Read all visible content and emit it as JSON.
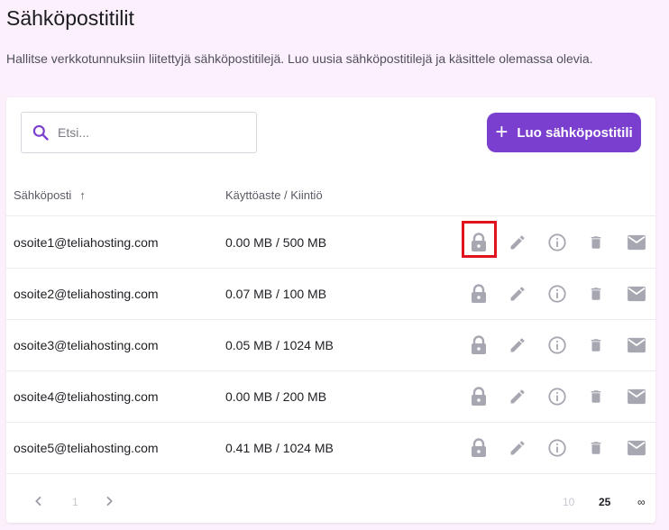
{
  "page": {
    "title": "Sähköpostitilit",
    "description": "Hallitse verkkotunnuksiin liitettyjä sähköpostitilejä. Luo uusia sähköpostitilejä ja käsittele olemassa olevia."
  },
  "toolbar": {
    "search_placeholder": "Etsi...",
    "create_label": "Luo sähköpostitili"
  },
  "table": {
    "columns": [
      "Sähköposti",
      "Käyttöaste / Kiintiö"
    ],
    "sort_indicator": "↑",
    "rows": [
      {
        "email": "osoite1@teliahosting.com",
        "usage": "0.00 MB / 500 MB"
      },
      {
        "email": "osoite2@teliahosting.com",
        "usage": "0.07 MB / 100 MB"
      },
      {
        "email": "osoite3@teliahosting.com",
        "usage": "0.05 MB / 1024 MB"
      },
      {
        "email": "osoite4@teliahosting.com",
        "usage": "0.00 MB / 200 MB"
      },
      {
        "email": "osoite5@teliahosting.com",
        "usage": "0.41 MB / 1024 MB"
      }
    ],
    "row_actions": [
      "lock-icon",
      "pencil-icon",
      "info-icon",
      "trash-icon",
      "mail-icon"
    ]
  },
  "pagination": {
    "current_page": "1",
    "page_sizes": [
      "10",
      "25",
      "∞"
    ],
    "selected_page_size": "25"
  },
  "colors": {
    "accent": "#7b3fd0",
    "background": "#fcf0fc",
    "icon": "#a7a7b2",
    "highlight": "#e0141e"
  }
}
